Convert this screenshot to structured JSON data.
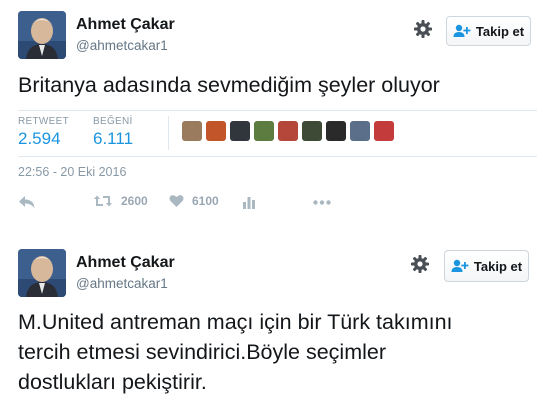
{
  "tweet1": {
    "user_name": "Ahmet Çakar",
    "user_handle": "@ahmetcakar1",
    "follow_label": "Takip et",
    "text": "Britanya adasında sevmediğim şeyler oluyor",
    "retweet_label": "RETWEET",
    "retweet_count": "2.594",
    "like_label": "BEĞENİ",
    "like_count": "6.111",
    "timestamp": "22:56 - 20 Eki 2016",
    "action_retweet_count": "2600",
    "action_like_count": "6100",
    "liker_colors": [
      "#9a7b5e",
      "#c2562a",
      "#30363c",
      "#5d7c40",
      "#b5473a",
      "#3e4a36",
      "#2a2a2a",
      "#5b6f8a",
      "#c33b3b"
    ]
  },
  "tweet2": {
    "user_name": "Ahmet Çakar",
    "user_handle": "@ahmetcakar1",
    "follow_label": "Takip et",
    "text_lines": [
      "M.United antreman maçı için bir Türk takımını",
      "tercih etmesi sevindirici.Böyle seçimler",
      "dostlukları pekiştirir."
    ]
  },
  "colors": {
    "accent": "#1b95e0",
    "muted": "#8899a6",
    "follow_icon": "#1b95e0"
  }
}
